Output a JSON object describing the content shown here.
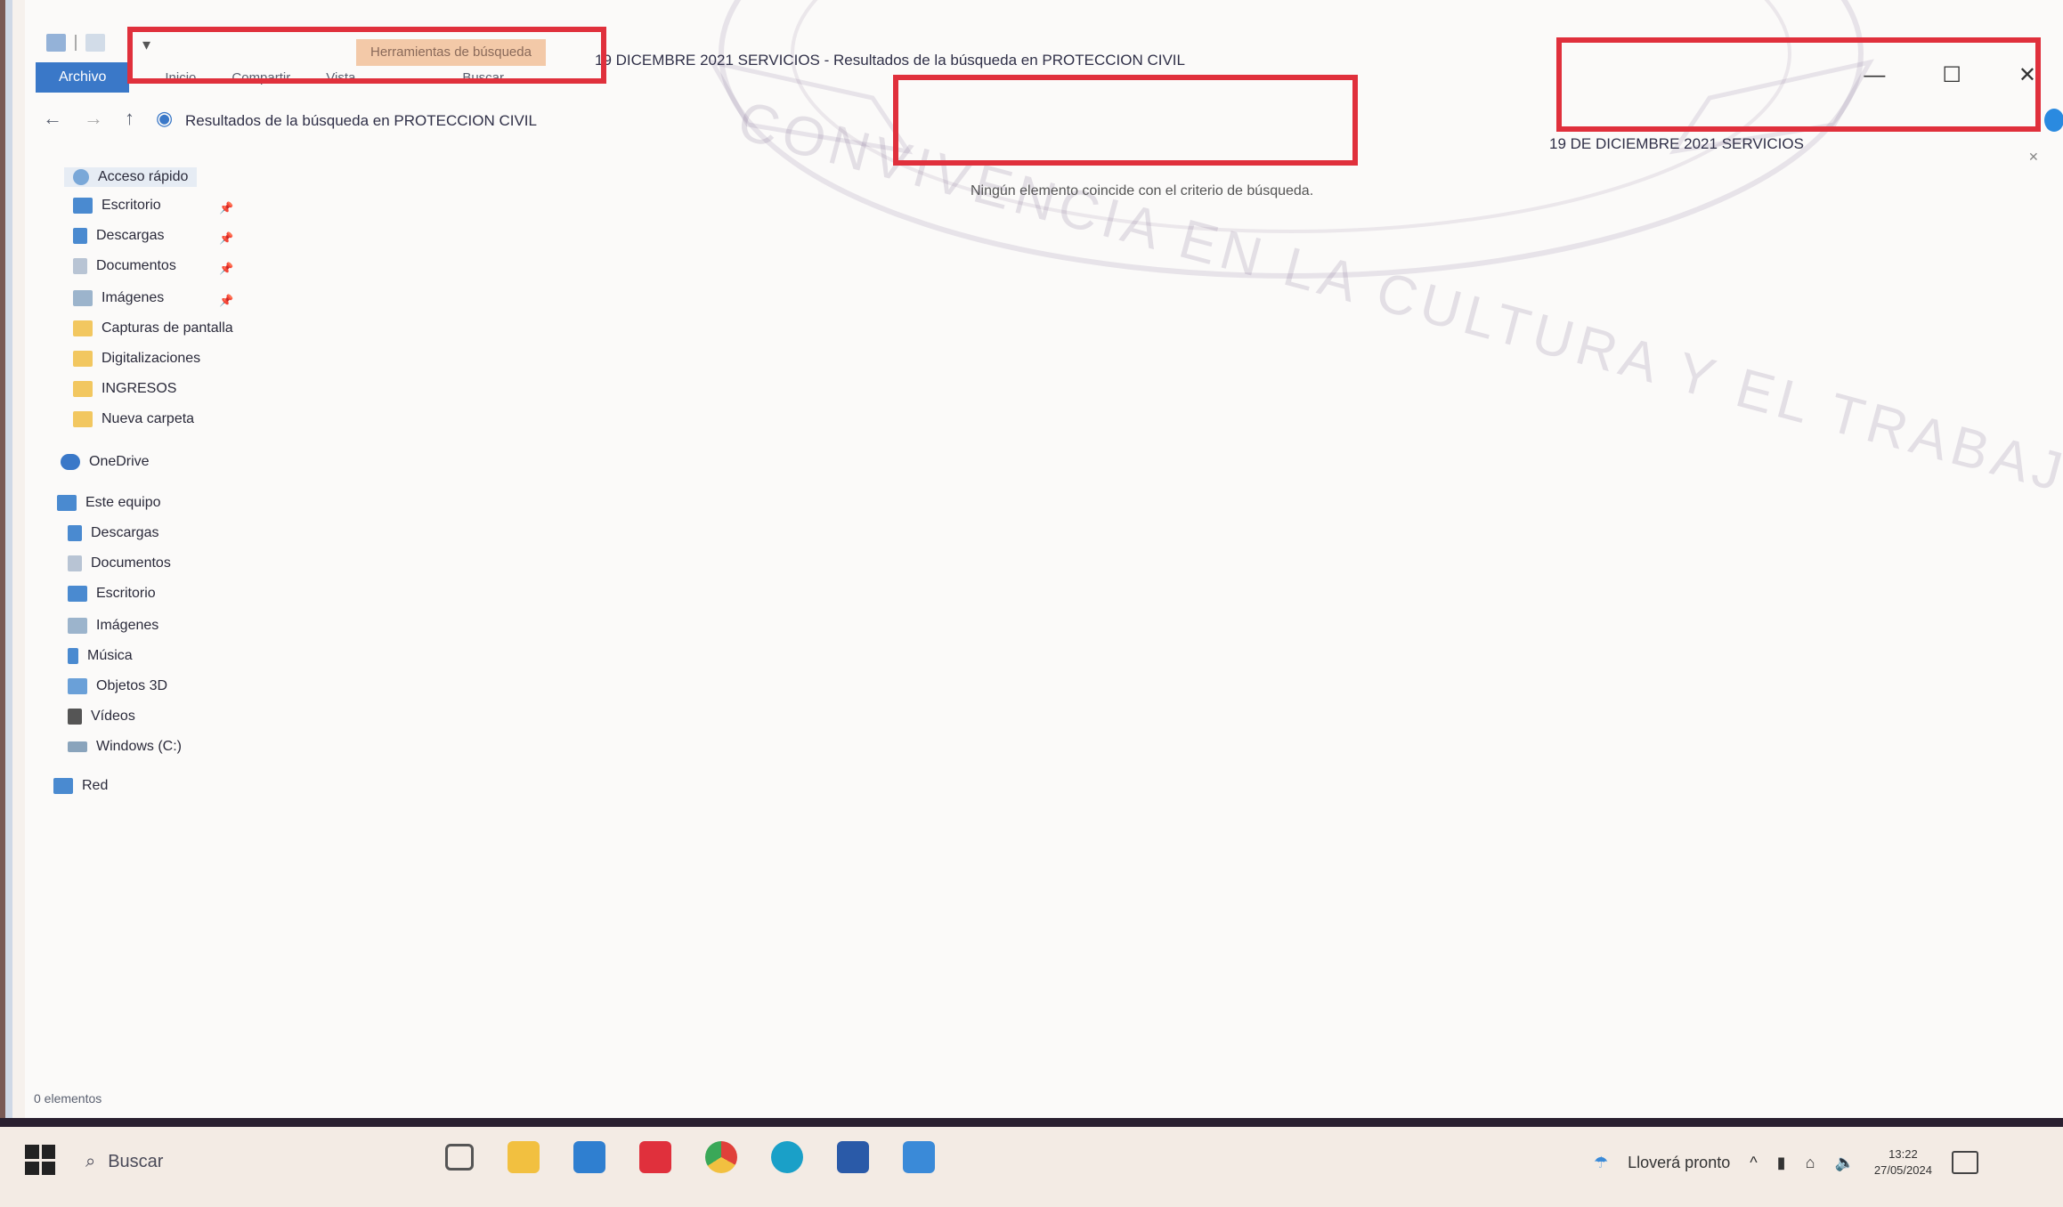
{
  "window": {
    "title": "19 DICEMBRE 2021 SERVICIOS - Resultados de la búsqueda en PROTECCION CIVIL",
    "ribbon_context_label": "Herramientas de búsqueda",
    "ribbon_tabs": [
      "Archivo",
      "Inicio",
      "Compartir",
      "Vista",
      "Buscar"
    ],
    "controls": {
      "minimize": "—",
      "maximize": "☐",
      "close": "✕"
    }
  },
  "watermark_text": "CONVIVENCIA EN LA CULTURA Y EL TRABAJO",
  "address_bar": {
    "path": "Resultados de la búsqueda en PROTECCION CIVIL"
  },
  "search_box": {
    "value": "19 DE DICIEMBRE 2021 SERVICIOS"
  },
  "empty_message": "Ningún elemento coincide con el criterio de búsqueda.",
  "sidebar": {
    "quick_access_label": "Acceso rápido",
    "quick_access": [
      {
        "label": "Escritorio",
        "icon": "desktop-icon",
        "pinned": true
      },
      {
        "label": "Descargas",
        "icon": "download-icon",
        "pinned": true
      },
      {
        "label": "Documentos",
        "icon": "document-icon",
        "pinned": true
      },
      {
        "label": "Imágenes",
        "icon": "image-icon",
        "pinned": true
      },
      {
        "label": "Capturas de pantalla",
        "icon": "folder-icon",
        "pinned": false
      },
      {
        "label": "Digitalizaciones",
        "icon": "folder-icon",
        "pinned": false
      },
      {
        "label": "INGRESOS",
        "icon": "folder-icon",
        "pinned": false
      },
      {
        "label": "Nueva carpeta",
        "icon": "folder-icon",
        "pinned": false
      }
    ],
    "onedrive_label": "OneDrive",
    "this_pc_label": "Este equipo",
    "this_pc": [
      {
        "label": "Descargas",
        "icon": "download-icon"
      },
      {
        "label": "Documentos",
        "icon": "document-icon"
      },
      {
        "label": "Escritorio",
        "icon": "desktop-icon"
      },
      {
        "label": "Imágenes",
        "icon": "image-icon"
      },
      {
        "label": "Música",
        "icon": "music-icon"
      },
      {
        "label": "Objetos 3D",
        "icon": "cube-icon"
      },
      {
        "label": "Vídeos",
        "icon": "video-icon"
      },
      {
        "label": "Windows (C:)",
        "icon": "drive-icon"
      }
    ],
    "network_label": "Red"
  },
  "status_bar": {
    "items_count": "0 elementos"
  },
  "taskbar": {
    "search_placeholder": "Buscar",
    "weather_text": "Lloverá pronto",
    "time": "13:22",
    "date": "27/05/2024"
  },
  "colors": {
    "accent": "#3a78c8",
    "annotation_red": "#e0303c",
    "context_tab": "#f3c9a8"
  }
}
